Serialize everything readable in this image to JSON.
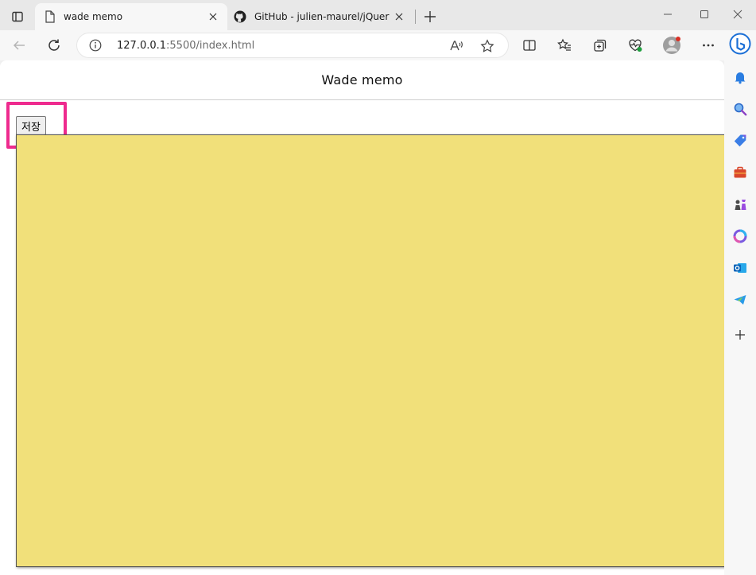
{
  "tabs": [
    {
      "label": "wade memo",
      "active": true
    },
    {
      "label": "GitHub - julien-maurel/jQuery-St",
      "active": false
    }
  ],
  "address": {
    "host": "127.0.0.1",
    "rest": ":5500/index.html"
  },
  "page": {
    "title": "Wade memo",
    "save_label": "저장",
    "memo_value": ""
  },
  "colors": {
    "memo_bg": "#f1e07a",
    "highlight": "#ee2a8e",
    "bing_blue": "#1b6fd6"
  },
  "icons": {
    "sidebar": [
      "bing-icon",
      "notification-bell-icon",
      "search-icon",
      "shopping-tag-icon",
      "tools-icon",
      "games-icon",
      "office-icon",
      "outlook-icon",
      "telegram-icon",
      "add-icon"
    ]
  }
}
